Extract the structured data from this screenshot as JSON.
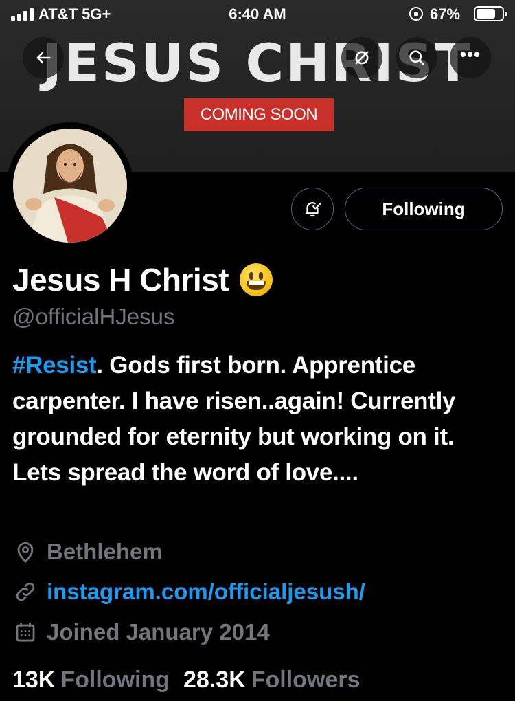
{
  "status_bar": {
    "carrier": "AT&T  5G+",
    "time": "6:40 AM",
    "battery": "67%"
  },
  "banner": {
    "title": "JESUS CHRIST",
    "badge": "COMING SOON"
  },
  "profile": {
    "display_name": "Jesus H Christ",
    "emoji": "grinning-face",
    "handle": "@officialHJesus",
    "bio_hashtag": "#Resist",
    "bio_text": ". Gods first born. Apprentice carpenter. I have risen..again! Currently grounded for eternity but working on it. Lets spread the word of love....",
    "location": "Bethlehem",
    "link": "instagram.com/officialjesush/",
    "joined": "Joined January 2014",
    "following_button": "Following"
  },
  "stats": {
    "following_count": "13K",
    "following_label": "Following",
    "followers_count": "28.3K",
    "followers_label": "Followers"
  },
  "colors": {
    "accent": "#1d9bf0",
    "muted": "#71767b",
    "badge": "#c9302a"
  }
}
